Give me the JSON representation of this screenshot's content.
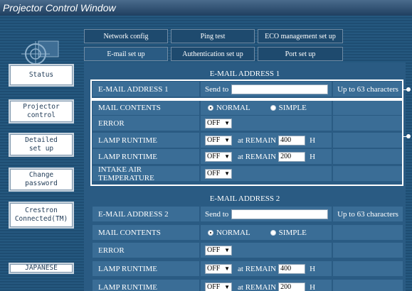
{
  "window": {
    "title": "Projector Control Window"
  },
  "sidebar": {
    "items": [
      {
        "label": "Status"
      },
      {
        "label": "Projector\ncontrol"
      },
      {
        "label": "Detailed\nset up"
      },
      {
        "label": "Change\npassword"
      },
      {
        "label": "Crestron\nConnected(TM)"
      },
      {
        "label": "JAPANESE"
      }
    ]
  },
  "tabs": {
    "row1": [
      {
        "label": "Network config"
      },
      {
        "label": "Ping test"
      },
      {
        "label": "ECO management set up"
      }
    ],
    "row2": [
      {
        "label": "E-mail set up"
      },
      {
        "label": "Authentication set up"
      },
      {
        "label": "Port set up"
      }
    ],
    "active": "E-mail set up"
  },
  "email1": {
    "heading": "E-MAIL ADDRESS 1",
    "address_label": "E-MAIL ADDRESS 1",
    "send_to": "Send to",
    "send_to_value": "",
    "limit": "Up to 63 characters",
    "mail_contents": "MAIL CONTENTS",
    "normal": "NORMAL",
    "simple": "SIMPLE",
    "error": "ERROR",
    "error_value": "OFF",
    "lamp1": "LAMP  RUNTIME",
    "lamp1_value": "OFF",
    "at_remain": "at REMAIN",
    "lamp1_remain": "400",
    "h": "H",
    "lamp2": "LAMP  RUNTIME",
    "lamp2_value": "OFF",
    "lamp2_remain": "200",
    "intake": "INTAKE AIR TEMPERATURE",
    "intake_value": "OFF"
  },
  "email2": {
    "heading": "E-MAIL ADDRESS 2",
    "address_label": "E-MAIL ADDRESS 2",
    "send_to": "Send to",
    "send_to_value": "",
    "limit": "Up to 63 characters",
    "mail_contents": "MAIL CONTENTS",
    "normal": "NORMAL",
    "simple": "SIMPLE",
    "error": "ERROR",
    "error_value": "OFF",
    "lamp1": "LAMP  RUNTIME",
    "lamp1_value": "OFF",
    "at_remain": "at REMAIN",
    "lamp1_remain": "400",
    "h": "H",
    "lamp2": "LAMP  RUNTIME",
    "lamp2_value": "OFF",
    "lamp2_remain": "200"
  },
  "colors": {
    "title_bar": "#2a4c6e",
    "frame": "#1e4d72",
    "content": "#2a5b83",
    "cell": "#3a6d96"
  }
}
